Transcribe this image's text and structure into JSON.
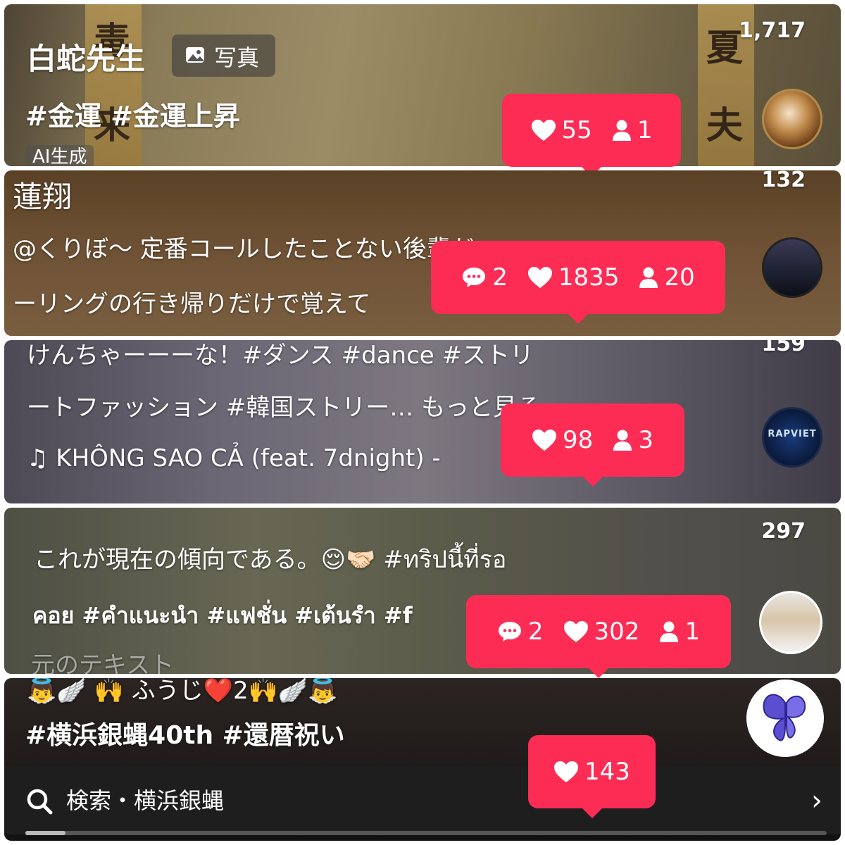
{
  "panels": [
    {
      "count": "1,717",
      "username": "白蛇先生",
      "badge": "写真",
      "hashtags": "#金運 #金運上昇",
      "ai_label": "AI生成",
      "tooltip": {
        "likes": "55",
        "viewers": "1"
      }
    },
    {
      "count": "132",
      "username": "蓮翔",
      "line1": "@くりぼ〜 定番コールしたことない後輩だッ",
      "line2": "ーリングの行き帰りだけで覚えて",
      "tooltip": {
        "comments": "2",
        "likes": "1835",
        "viewers": "20"
      }
    },
    {
      "count": "159",
      "line1": "けんちゃーーーな！#ダンス #dance #ストリ",
      "line2": "ートファッション #韓国ストリー… もっと見る",
      "music": "♫ KHÔNG SAO CẢ (feat. 7dnight) -",
      "avatar_text": "RAPVIET",
      "tooltip": {
        "likes": "98",
        "viewers": "3"
      }
    },
    {
      "count": "297",
      "line1": "これが現在の傾向である。😌🤝🏻 #ทริปนี้ที่รอ",
      "line2": "คอย #คำแนะนำ #แฟชั่น #เต้นรำ #f",
      "original_text_link": "元のテキスト",
      "tooltip": {
        "comments": "2",
        "likes": "302",
        "viewers": "1"
      }
    },
    {
      "line0": "👼🪽 🙌 ふうじ❤️2🙌🪽👼",
      "hashtags": "#横浜銀蝿40th #還暦祝い",
      "search": "検索・横浜銀蝿",
      "progress_fraction": 0.05,
      "tooltip": {
        "likes": "143"
      }
    }
  ],
  "colors": {
    "tooltip": "#fd2c55",
    "search_bar": "#1e1e1e"
  },
  "icons": {
    "like": "heart-icon",
    "viewer": "person-icon",
    "comment": "comment-icon",
    "search": "search-icon",
    "chevron": "chevron-right-icon",
    "photo": "photo-icon"
  }
}
